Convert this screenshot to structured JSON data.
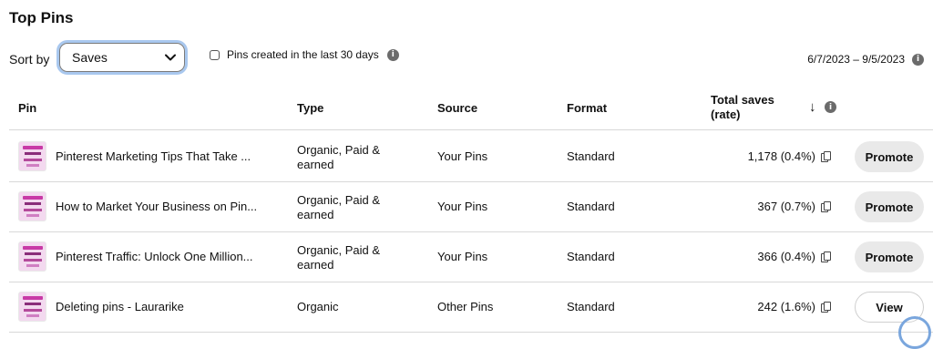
{
  "title": "Top Pins",
  "sort": {
    "label": "Sort by",
    "selected": "Saves"
  },
  "filter": {
    "checkbox_label": "Pins created in the last 30 days",
    "checked": false
  },
  "date_range": "6/7/2023 – 9/5/2023",
  "table": {
    "columns": {
      "pin": "Pin",
      "type": "Type",
      "source": "Source",
      "format": "Format",
      "saves_line1": "Total saves",
      "saves_line2": "(rate)",
      "sort_arrow": "↓"
    },
    "rows": [
      {
        "title": "Pinterest Marketing Tips That Take ...",
        "type_line1": "Organic, Paid &",
        "type_line2": "earned",
        "source": "Your Pins",
        "format": "Standard",
        "saves": "1,178 (0.4%)",
        "action": "Promote"
      },
      {
        "title": "How to Market Your Business on Pin...",
        "type_line1": "Organic, Paid &",
        "type_line2": "earned",
        "source": "Your Pins",
        "format": "Standard",
        "saves": "367 (0.7%)",
        "action": "Promote"
      },
      {
        "title": "Pinterest Traffic: Unlock One Million...",
        "type_line1": "Organic, Paid &",
        "type_line2": "earned",
        "source": "Your Pins",
        "format": "Standard",
        "saves": "366 (0.4%)",
        "action": "Promote"
      },
      {
        "title": "Deleting pins - Laurarike",
        "type_line1": "Organic",
        "type_line2": "",
        "source": "Other Pins",
        "format": "Standard",
        "saves": "242 (1.6%)",
        "action": "View"
      }
    ]
  },
  "icons": {
    "info": "info-icon",
    "chevron": "chevron-down-icon",
    "copy": "copy-icon"
  },
  "colors": {
    "focus_ring": "#a9c8ef",
    "button_bg": "#e9e9e9"
  }
}
